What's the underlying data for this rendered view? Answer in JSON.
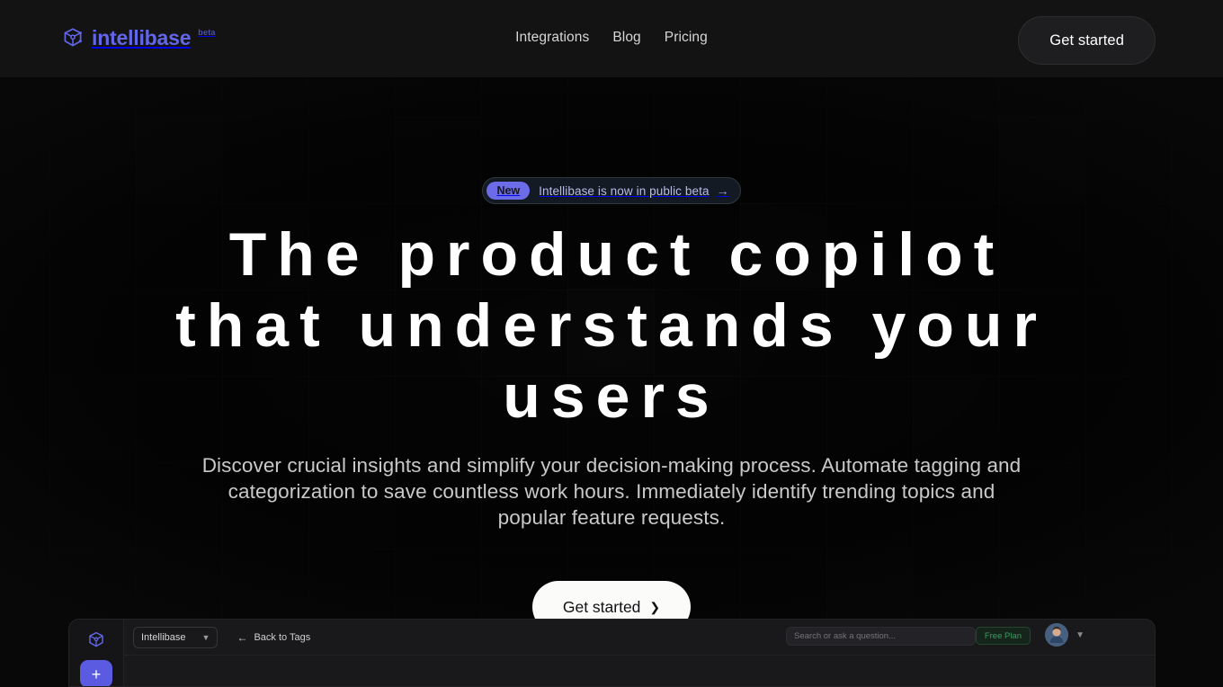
{
  "brand": {
    "name": "intellibase",
    "suffix": "beta",
    "logo_icon": "cube-node-icon",
    "accent_color": "#6366e8"
  },
  "header": {
    "nav": [
      {
        "label": "Integrations",
        "name": "nav-integrations"
      },
      {
        "label": "Blog",
        "name": "nav-blog"
      },
      {
        "label": "Pricing",
        "name": "nav-pricing"
      }
    ],
    "cta_label": "Get started"
  },
  "hero": {
    "badge": {
      "tag": "New",
      "text": "Intellibase is now in public beta",
      "arrow_icon": "arrow-right-icon",
      "tag_color": "#6c6ce8",
      "border_color": "#2b3a3d"
    },
    "headline": "The product copilot that understands your users",
    "subhead": "Discover crucial insights and simplify your decision-making process. Automate tagging and categorization to save countless work hours. Immediately identify trending topics and popular feature requests.",
    "cta_label": "Get started",
    "cta_icon": "chevron-right-icon"
  },
  "app_preview": {
    "sidebar": {
      "logo_icon": "cube-node-icon",
      "add_label": "+",
      "add_color": "#5b5be2"
    },
    "workspace": {
      "label": "Intellibase",
      "caret_icon": "chevron-down-icon"
    },
    "back_link": {
      "label": "Back to Tags",
      "icon": "arrow-left-icon"
    },
    "search": {
      "placeholder": "Search or ask a question...",
      "value": ""
    },
    "plan_badge": {
      "label": "Free Plan",
      "color": "#3f9960"
    },
    "avatar": {
      "name": "user-avatar",
      "caret_icon": "chevron-down-icon"
    }
  }
}
